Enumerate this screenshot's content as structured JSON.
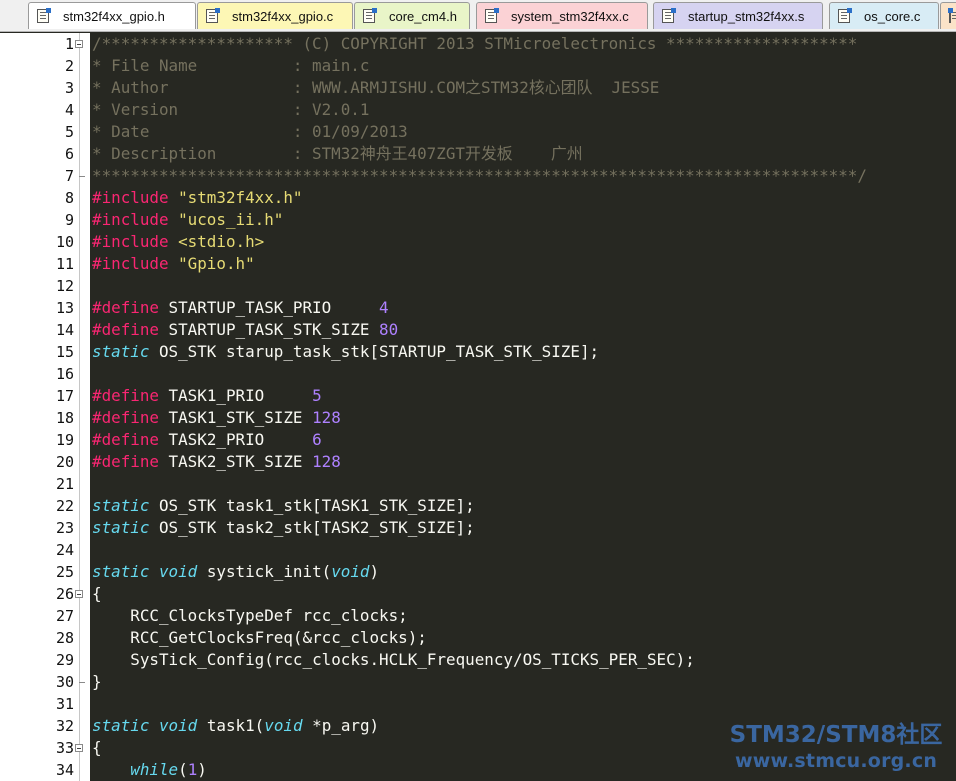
{
  "tabs": [
    {
      "label": "stm32f4xx_gpio.h",
      "bg": "#ffffff",
      "active": false
    },
    {
      "label": "stm32f4xx_gpio.c",
      "bg": "#fdf7b5",
      "active": false
    },
    {
      "label": "core_cm4.h",
      "bg": "#e9f5c8",
      "active": false
    },
    {
      "label": "system_stm32f4xx.c",
      "bg": "#fbd2d5",
      "active": false
    },
    {
      "label": "startup_stm32f4xx.s",
      "bg": "#d6d3f1",
      "active": false
    },
    {
      "label": "os_core.c",
      "bg": "#d8ecf5",
      "active": false
    },
    {
      "label": "",
      "bg": "#fbe3c8",
      "active": false
    }
  ],
  "colors": {
    "background": "#272822",
    "comment": "#75715e",
    "preprocessor": "#f92672",
    "string": "#e6db74",
    "number": "#ae81ff",
    "type_keyword": "#66d9ef",
    "text": "#f8f8f2",
    "gutter_bg": "#ffffff",
    "line_number": "#111111",
    "watermark": "#4078c4"
  },
  "code_lines": [
    {
      "n": "1",
      "seg": [
        [
          "comment",
          "/******************** (C) COPYRIGHT 2013 STMicroelectronics ********************"
        ]
      ]
    },
    {
      "n": "2",
      "seg": [
        [
          "comment",
          "* File Name          : main.c"
        ]
      ]
    },
    {
      "n": "3",
      "seg": [
        [
          "comment",
          "* Author             : WWW.ARMJISHU.COM之STM32核心团队  JESSE"
        ]
      ]
    },
    {
      "n": "4",
      "seg": [
        [
          "comment",
          "* Version            : V2.0.1"
        ]
      ]
    },
    {
      "n": "5",
      "seg": [
        [
          "comment",
          "* Date               : 01/09/2013"
        ]
      ]
    },
    {
      "n": "6",
      "seg": [
        [
          "comment",
          "* Description        : STM32神舟王407ZGT开发板    广州"
        ]
      ]
    },
    {
      "n": "7",
      "seg": [
        [
          "comment",
          "********************************************************************************/"
        ]
      ]
    },
    {
      "n": "8",
      "seg": [
        [
          "pp",
          "#include "
        ],
        [
          "str",
          "\"stm32f4xx.h\""
        ]
      ]
    },
    {
      "n": "9",
      "seg": [
        [
          "pp",
          "#include "
        ],
        [
          "str",
          "\"ucos_ii.h\""
        ]
      ]
    },
    {
      "n": "10",
      "seg": [
        [
          "pp",
          "#include "
        ],
        [
          "str",
          "<stdio.h>"
        ]
      ]
    },
    {
      "n": "11",
      "seg": [
        [
          "pp",
          "#include "
        ],
        [
          "str",
          "\"Gpio.h\""
        ]
      ]
    },
    {
      "n": "12",
      "seg": []
    },
    {
      "n": "13",
      "seg": [
        [
          "pp",
          "#define "
        ],
        [
          "text",
          "STARTUP_TASK_PRIO     "
        ],
        [
          "num",
          "4"
        ]
      ]
    },
    {
      "n": "14",
      "seg": [
        [
          "pp",
          "#define "
        ],
        [
          "text",
          "STARTUP_TASK_STK_SIZE "
        ],
        [
          "num",
          "80"
        ]
      ]
    },
    {
      "n": "15",
      "seg": [
        [
          "kw",
          "static"
        ],
        [
          "text",
          " OS_STK starup_task_stk"
        ],
        [
          "punct",
          "["
        ],
        [
          "text",
          "STARTUP_TASK_STK_SIZE"
        ],
        [
          "punct",
          "];"
        ]
      ]
    },
    {
      "n": "16",
      "seg": []
    },
    {
      "n": "17",
      "seg": [
        [
          "pp",
          "#define "
        ],
        [
          "text",
          "TASK1_PRIO     "
        ],
        [
          "num",
          "5"
        ]
      ]
    },
    {
      "n": "18",
      "seg": [
        [
          "pp",
          "#define "
        ],
        [
          "text",
          "TASK1_STK_SIZE "
        ],
        [
          "num",
          "128"
        ]
      ]
    },
    {
      "n": "19",
      "seg": [
        [
          "pp",
          "#define "
        ],
        [
          "text",
          "TASK2_PRIO     "
        ],
        [
          "num",
          "6"
        ]
      ]
    },
    {
      "n": "20",
      "seg": [
        [
          "pp",
          "#define "
        ],
        [
          "text",
          "TASK2_STK_SIZE "
        ],
        [
          "num",
          "128"
        ]
      ]
    },
    {
      "n": "21",
      "seg": []
    },
    {
      "n": "22",
      "seg": [
        [
          "kw",
          "static"
        ],
        [
          "text",
          " OS_STK task1_stk"
        ],
        [
          "punct",
          "["
        ],
        [
          "text",
          "TASK1_STK_SIZE"
        ],
        [
          "punct",
          "];"
        ]
      ]
    },
    {
      "n": "23",
      "seg": [
        [
          "kw",
          "static"
        ],
        [
          "text",
          " OS_STK task2_stk"
        ],
        [
          "punct",
          "["
        ],
        [
          "text",
          "TASK2_STK_SIZE"
        ],
        [
          "punct",
          "];"
        ]
      ]
    },
    {
      "n": "24",
      "seg": []
    },
    {
      "n": "25",
      "seg": [
        [
          "kw",
          "static"
        ],
        [
          "text",
          " "
        ],
        [
          "kw",
          "void"
        ],
        [
          "text",
          " systick_init"
        ],
        [
          "punct",
          "("
        ],
        [
          "kw",
          "void"
        ],
        [
          "punct",
          ")"
        ]
      ]
    },
    {
      "n": "26",
      "seg": [
        [
          "punct",
          "{"
        ]
      ]
    },
    {
      "n": "27",
      "seg": [
        [
          "text",
          "    RCC_ClocksTypeDef rcc_clocks"
        ],
        [
          "punct",
          ";"
        ]
      ]
    },
    {
      "n": "28",
      "seg": [
        [
          "text",
          "    RCC_GetClocksFreq"
        ],
        [
          "punct",
          "(&"
        ],
        [
          "text",
          "rcc_clocks"
        ],
        [
          "punct",
          ");"
        ]
      ]
    },
    {
      "n": "29",
      "seg": [
        [
          "text",
          "    SysTick_Config"
        ],
        [
          "punct",
          "("
        ],
        [
          "text",
          "rcc_clocks"
        ],
        [
          "punct",
          "."
        ],
        [
          "text",
          "HCLK_Frequency"
        ],
        [
          "punct",
          "/"
        ],
        [
          "text",
          "OS_TICKS_PER_SEC"
        ],
        [
          "punct",
          ");"
        ]
      ]
    },
    {
      "n": "30",
      "seg": [
        [
          "punct",
          "}"
        ]
      ]
    },
    {
      "n": "31",
      "seg": []
    },
    {
      "n": "32",
      "seg": [
        [
          "kw",
          "static"
        ],
        [
          "text",
          " "
        ],
        [
          "kw",
          "void"
        ],
        [
          "text",
          " task1"
        ],
        [
          "punct",
          "("
        ],
        [
          "kw",
          "void"
        ],
        [
          "text",
          " "
        ],
        [
          "punct",
          "*"
        ],
        [
          "text",
          "p_arg"
        ],
        [
          "punct",
          ")"
        ]
      ]
    },
    {
      "n": "33",
      "seg": [
        [
          "punct",
          "{"
        ]
      ]
    },
    {
      "n": "34",
      "seg": [
        [
          "text",
          "    "
        ],
        [
          "kw",
          "while"
        ],
        [
          "punct",
          "("
        ],
        [
          "num",
          "1"
        ],
        [
          "punct",
          ")"
        ]
      ]
    }
  ],
  "watermark": {
    "line1": "STM32/STM8社区",
    "line2": "www.stmcu.org.cn"
  }
}
